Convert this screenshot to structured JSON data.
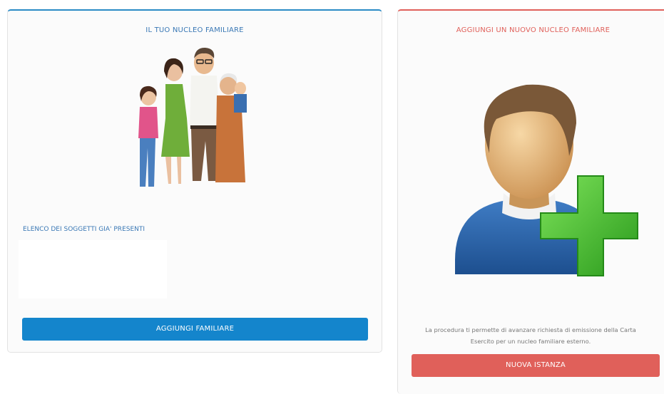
{
  "family_card": {
    "title": "IL TUO NUCLEO FAMILIARE",
    "list_label": "ELENCO DEI SOGGETTI GIA' PRESENTI",
    "button_label": "AGGIUNGI FAMILIARE",
    "illustration": "family-illustration"
  },
  "new_card": {
    "title": "AGGIUNGI UN NUOVO NUCLEO FAMILIARE",
    "description": "La procedura ti permette di avanzare richiesta di emissione della Carta Esercito per un nucleo familiare esterno.",
    "button_label": "NUOVA ISTANZA",
    "illustration": "add-user-illustration"
  },
  "colors": {
    "primary_blue": "#1485cc",
    "accent_red": "#e0605a",
    "cross_green": "#3fbf2e"
  }
}
